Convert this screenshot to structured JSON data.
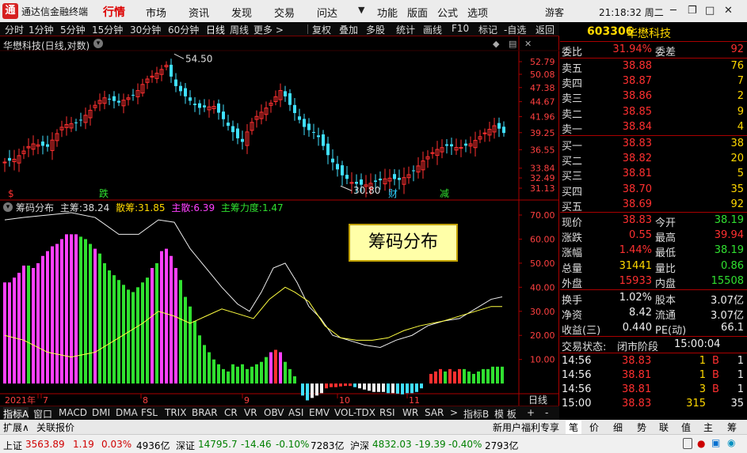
{
  "app": {
    "title": "通达信金融终端",
    "logo": "通"
  },
  "menu": {
    "items": [
      "行情",
      "市场",
      "资讯",
      "发现",
      "交易",
      "问达",
      "功能",
      "版面",
      "公式",
      "选项"
    ],
    "active": "行情",
    "user": "游客",
    "clock": "21:18:32 周二"
  },
  "toolbar": {
    "items": [
      "分时",
      "1分钟",
      "5分钟",
      "15分钟",
      "30分钟",
      "60分钟",
      "日线",
      "周线",
      "更多 >",
      "复权",
      "叠加",
      "多股",
      "统计",
      "画线",
      "F10",
      "标记",
      "-自选",
      "返回"
    ],
    "active": "日线"
  },
  "kchart": {
    "title": "华懋科技(日线,对数)",
    "yticks": [
      "52.79",
      "50.08",
      "47.38",
      "44.67",
      "41.96",
      "39.25",
      "36.55",
      "33.84",
      "32.49",
      "31.13"
    ],
    "high_label": "54.50",
    "low_label": "30.80",
    "markers": [
      {
        "text": "$",
        "color": "#ff3030"
      },
      {
        "text": "跌",
        "color": "#30e030"
      },
      {
        "text": "财",
        "color": "#30d0ff"
      },
      {
        "text": "减",
        "color": "#30e030"
      }
    ]
  },
  "indicator": {
    "name": "筹码分布",
    "main_label": "主筹:",
    "main_value": "38.24",
    "retail_label": "散筹:",
    "retail_value": "31.85",
    "main_dist_label": "主散:",
    "main_dist_value": "6.39",
    "strength_label": "主筹力度:",
    "strength_value": "1.47",
    "yticks": [
      "70.00",
      "60.00",
      "50.00",
      "40.00",
      "30.00",
      "20.00",
      "10.00"
    ],
    "callout": "筹码分布"
  },
  "xaxis": {
    "labels": [
      "2021年",
      "7",
      "8",
      "9",
      "10",
      "11"
    ],
    "period": "日线"
  },
  "bottom_tabs": {
    "items": [
      "指标A",
      "窗口",
      "MACD",
      "DMI",
      "DMA",
      "FSL",
      "TRIX",
      "BRAR",
      "CR",
      "VR",
      "OBV",
      "ASI",
      "EMV",
      "VOL-TDX",
      "RSI",
      "WR",
      "SAR",
      ">",
      "指标B",
      "模 板",
      "+",
      "-"
    ]
  },
  "status": {
    "expand": "扩展∧",
    "link": "关联报价",
    "promo": "新用户福利专享"
  },
  "status_tabs": [
    "笔",
    "价",
    "细",
    "势",
    "联",
    "值",
    "主",
    "筹"
  ],
  "ticker": [
    {
      "name": "上证",
      "price": "3563.89",
      "chg": "1.19",
      "pct": "0.03%",
      "amt": "4936亿",
      "dir": "up"
    },
    {
      "name": "深证",
      "price": "14795.7",
      "chg": "-14.46",
      "pct": "-0.10%",
      "amt": "7283亿",
      "dir": "down"
    },
    {
      "name": "沪深",
      "price": "4832.03",
      "chg": "-19.39",
      "pct": "-0.40%",
      "amt": "2793亿",
      "dir": "down"
    }
  ],
  "quote": {
    "code": "603306",
    "name": "华懋科技",
    "ratio_label": "委比",
    "ratio": "31.94%",
    "diff_label": "委差",
    "diff": "92",
    "asks": [
      {
        "label": "卖五",
        "price": "38.88",
        "vol": "76"
      },
      {
        "label": "卖四",
        "price": "38.87",
        "vol": "7"
      },
      {
        "label": "卖三",
        "price": "38.86",
        "vol": "2"
      },
      {
        "label": "卖二",
        "price": "38.85",
        "vol": "9"
      },
      {
        "label": "卖一",
        "price": "38.84",
        "vol": "4"
      }
    ],
    "bids": [
      {
        "label": "买一",
        "price": "38.83",
        "vol": "38"
      },
      {
        "label": "买二",
        "price": "38.82",
        "vol": "20"
      },
      {
        "label": "买三",
        "price": "38.81",
        "vol": "5"
      },
      {
        "label": "买四",
        "price": "38.70",
        "vol": "35"
      },
      {
        "label": "买五",
        "price": "38.69",
        "vol": "92"
      }
    ],
    "stats": [
      {
        "l1": "现价",
        "v1": "38.83",
        "c1": "r",
        "l2": "今开",
        "v2": "38.19",
        "c2": "g"
      },
      {
        "l1": "涨跌",
        "v1": "0.55",
        "c1": "r",
        "l2": "最高",
        "v2": "39.94",
        "c2": "r"
      },
      {
        "l1": "涨幅",
        "v1": "1.44%",
        "c1": "r",
        "l2": "最低",
        "v2": "38.19",
        "c2": "g"
      },
      {
        "l1": "总量",
        "v1": "31441",
        "c1": "y",
        "l2": "量比",
        "v2": "0.86",
        "c2": "g"
      },
      {
        "l1": "外盘",
        "v1": "15933",
        "c1": "r",
        "l2": "内盘",
        "v2": "15508",
        "c2": "g"
      }
    ],
    "stats2": [
      {
        "l1": "换手",
        "v1": "1.02%",
        "l2": "股本",
        "v2": "3.07亿"
      },
      {
        "l1": "净资",
        "v1": "8.42",
        "l2": "流通",
        "v2": "3.07亿"
      },
      {
        "l1": "收益(三)",
        "v1": "0.440",
        "l2": "PE(动)",
        "v2": "66.1"
      }
    ],
    "phase_label": "交易状态:",
    "phase": "闭市阶段",
    "phase_time": "15:00:04",
    "ticks": [
      {
        "time": "14:56",
        "price": "38.83",
        "vol": "1",
        "side": "B",
        "num": "1"
      },
      {
        "time": "14:56",
        "price": "38.81",
        "vol": "1",
        "side": "B",
        "num": "1"
      },
      {
        "time": "14:56",
        "price": "38.81",
        "vol": "3",
        "side": "B",
        "num": "1"
      },
      {
        "time": "15:00",
        "price": "38.83",
        "vol": "315",
        "side": "",
        "num": "35"
      }
    ]
  },
  "colors": {
    "up": "#ff3030",
    "down": "#30e030",
    "accent": "#ffd800",
    "border": "#aa0000"
  }
}
